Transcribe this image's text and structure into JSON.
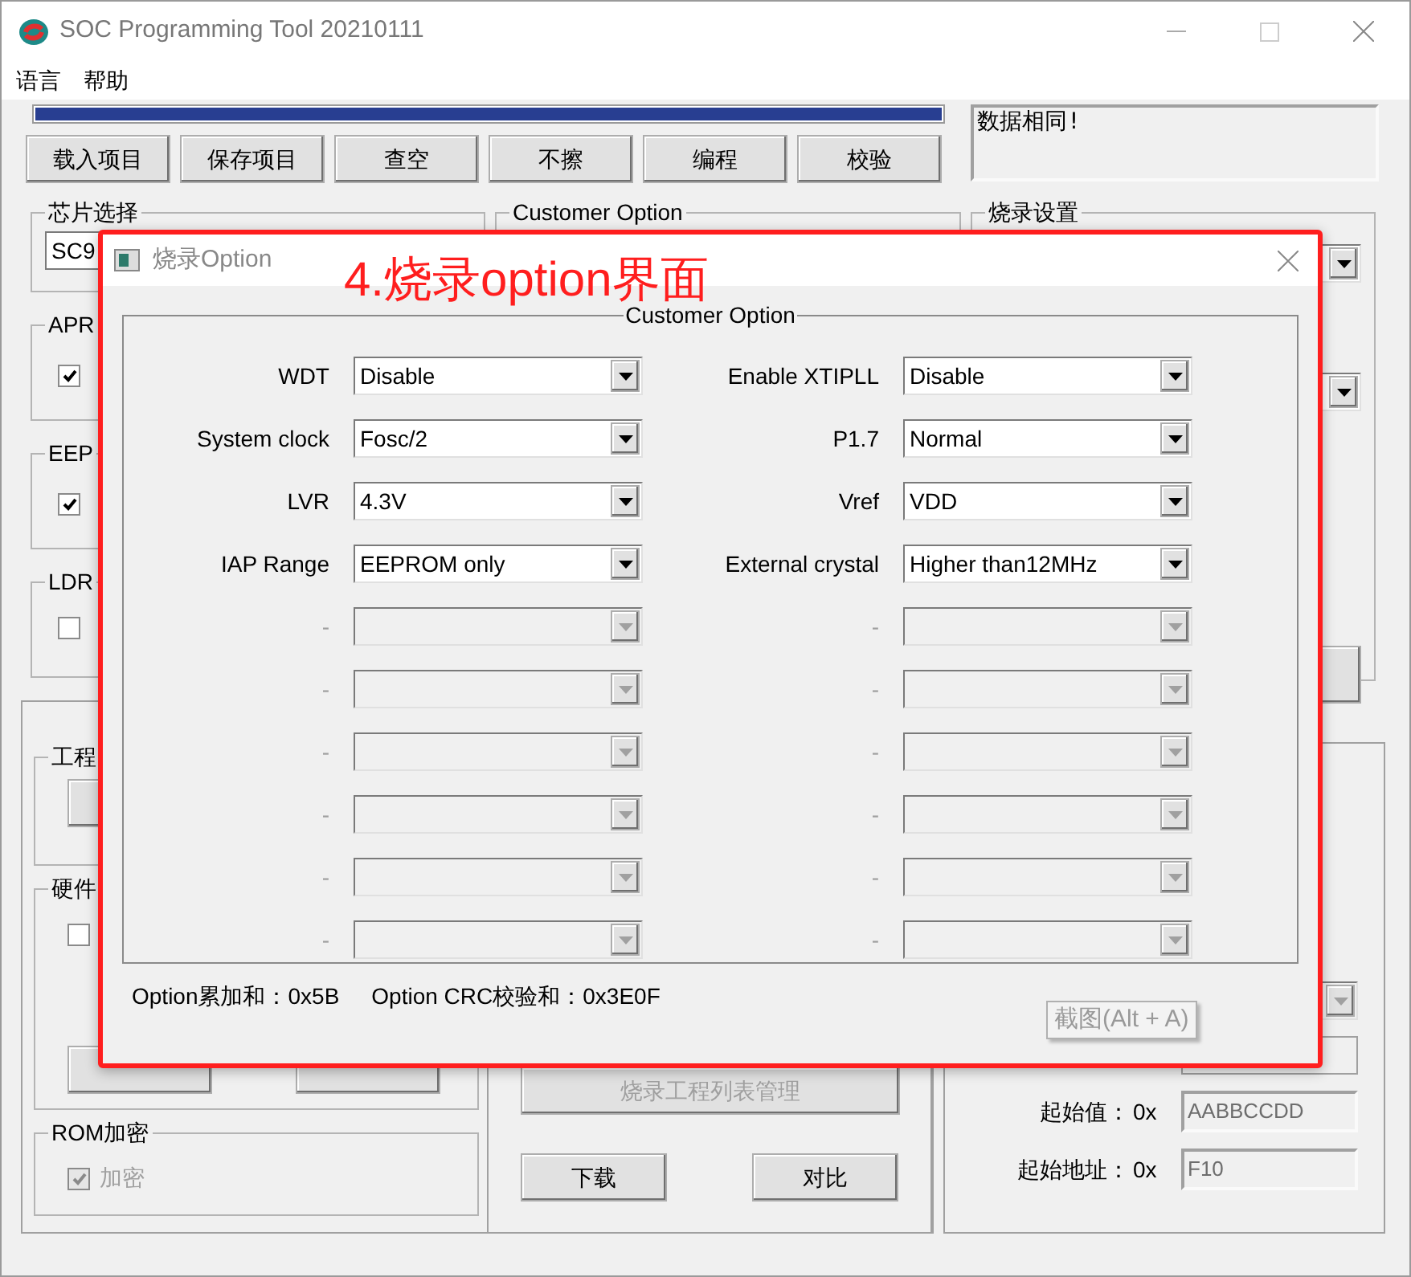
{
  "window": {
    "title": "SOC Programming Tool 20210111"
  },
  "menu": [
    {
      "label": "语言"
    },
    {
      "label": "帮助"
    }
  ],
  "progress": {
    "level": 1
  },
  "toolbar_buttons": [
    "载入项目",
    "保存项目",
    "查空",
    "不擦",
    "编程",
    "校验"
  ],
  "message": "数据相同!",
  "chip_select": {
    "title": "芯片选择",
    "value": "SC9"
  },
  "customer_option": {
    "title": "Customer Option"
  },
  "burn_settings": {
    "title": "烧录设置"
  },
  "feature_groups": [
    {
      "title": "APR",
      "checked": true
    },
    {
      "title": "EEP",
      "checked": true
    },
    {
      "title": "LDR",
      "checked": false
    }
  ],
  "project_group": {
    "title": "工程"
  },
  "hardware_group": {
    "title": "硬件",
    "checked": false
  },
  "rom_encrypt": {
    "title": "ROM加密",
    "option": {
      "label": "加密",
      "checked": true,
      "disabled": true
    }
  },
  "project_list_button": {
    "label": "烧录工程列表管理",
    "disabled": true
  },
  "action_buttons": [
    "下载",
    "对比"
  ],
  "address_fields": [
    {
      "label": "起始值：",
      "prefix": "0x",
      "value": "AABBCCDD"
    },
    {
      "label": "起始地址：",
      "prefix": "0x",
      "value": "F10"
    }
  ],
  "dialog": {
    "title": "烧录Option",
    "group_title": "Customer Option",
    "left_options": [
      {
        "label": "WDT",
        "value": "Disable",
        "disabled": false
      },
      {
        "label": "System clock",
        "value": "Fosc/2",
        "disabled": false
      },
      {
        "label": "LVR",
        "value": "4.3V",
        "disabled": false
      },
      {
        "label": "IAP Range",
        "value": "EEPROM only",
        "disabled": false
      },
      {
        "label": "-",
        "disabled": true
      },
      {
        "label": "-",
        "disabled": true
      },
      {
        "label": "-",
        "disabled": true
      },
      {
        "label": "-",
        "disabled": true
      },
      {
        "label": "-",
        "disabled": true
      },
      {
        "label": "-",
        "disabled": true
      }
    ],
    "right_options": [
      {
        "label": "Enable XTIPLL",
        "value": "Disable",
        "disabled": false
      },
      {
        "label": "P1.7",
        "value": "Normal",
        "disabled": false
      },
      {
        "label": "Vref",
        "value": "VDD",
        "disabled": false
      },
      {
        "label": "External crystal",
        "value": "Higher than12MHz",
        "disabled": false
      },
      {
        "label": "-",
        "disabled": true
      },
      {
        "label": "-",
        "disabled": true
      },
      {
        "label": "-",
        "disabled": true
      },
      {
        "label": "-",
        "disabled": true
      },
      {
        "label": "-",
        "disabled": true
      },
      {
        "label": "-",
        "disabled": true
      }
    ],
    "checksum": "Option累加和：0x5B",
    "crc": "Option CRC校验和：0x3E0F"
  },
  "annotation": "4.烧录option界面",
  "tooltip": "截图(Alt + A)"
}
